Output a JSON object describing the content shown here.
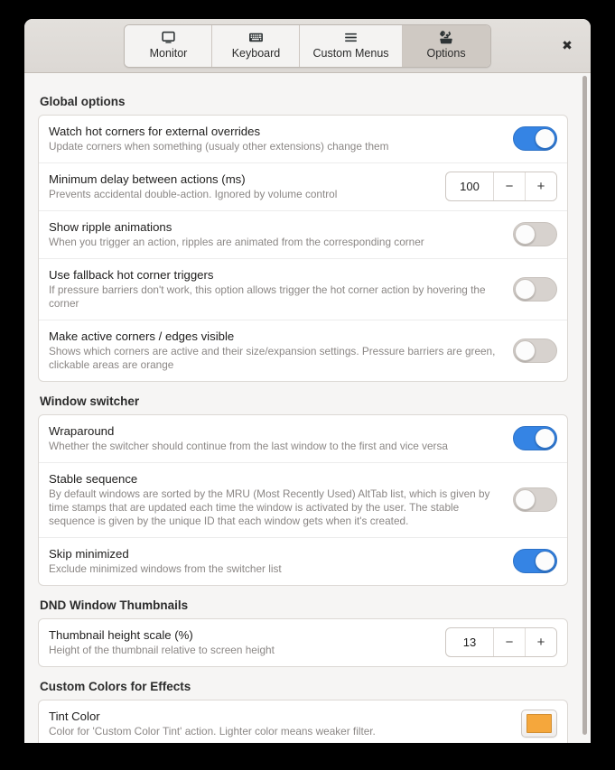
{
  "window": {
    "close_label": "✖"
  },
  "tabs": [
    {
      "label": "Monitor",
      "icon": "monitor-icon",
      "selected": false
    },
    {
      "label": "Keyboard",
      "icon": "keyboard-icon",
      "selected": false
    },
    {
      "label": "Custom Menus",
      "icon": "hamburger-menu-icon",
      "selected": false
    },
    {
      "label": "Options",
      "icon": "preferences-icon",
      "selected": true
    }
  ],
  "sections": [
    {
      "title": "Global options",
      "rows": [
        {
          "name": "watch-hot-corners",
          "title": "Watch hot corners for external overrides",
          "subtitle": "Update corners when something (usualy other extensions) change them",
          "control": "switch",
          "value": "on"
        },
        {
          "name": "minimum-delay",
          "title": "Minimum delay between actions (ms)",
          "subtitle": "Prevents accidental double-action. Ignored by volume control",
          "control": "spin",
          "value": "100",
          "minus_label": "−",
          "plus_label": "+"
        },
        {
          "name": "show-ripple-animations",
          "title": "Show ripple animations",
          "subtitle": "When you trigger an action, ripples are animated from the corresponding corner",
          "control": "switch",
          "value": "off"
        },
        {
          "name": "use-fallback-triggers",
          "title": "Use fallback hot corner triggers",
          "subtitle": "If pressure barriers don't work, this option allows trigger the hot corner action by hovering the corner",
          "control": "switch",
          "value": "off"
        },
        {
          "name": "make-corners-visible",
          "title": "Make active corners / edges visible",
          "subtitle": "Shows which corners are active and their size/expansion settings. Pressure barriers are green, clickable areas are orange",
          "control": "switch",
          "value": "off"
        }
      ]
    },
    {
      "title": "Window switcher",
      "rows": [
        {
          "name": "wraparound",
          "title": "Wraparound",
          "subtitle": "Whether the switcher should continue from the last window to the first and vice versa",
          "control": "switch",
          "value": "on"
        },
        {
          "name": "stable-sequence",
          "title": "Stable sequence",
          "subtitle": "By default windows are sorted by the MRU (Most Recently Used) AltTab list, which is given by time stamps that are updated each time the window is activated by the user. The stable sequence is given by the unique ID that each window gets when it's created.",
          "control": "switch",
          "value": "off"
        },
        {
          "name": "skip-minimized",
          "title": "Skip minimized",
          "subtitle": "Exclude minimized windows from the switcher list",
          "control": "switch",
          "value": "on"
        }
      ]
    },
    {
      "title": "DND Window Thumbnails",
      "rows": [
        {
          "name": "thumbnail-height-scale",
          "title": "Thumbnail height scale (%)",
          "subtitle": "Height of the thumbnail relative to screen height",
          "control": "spin",
          "value": "13",
          "minus_label": "−",
          "plus_label": "+"
        }
      ]
    },
    {
      "title": "Custom Colors for Effects",
      "rows": [
        {
          "name": "tint-color",
          "title": "Tint Color",
          "subtitle": "Color for 'Custom Color Tint' action. Lighter color means weaker filter.",
          "control": "color",
          "value": "#f5a73c"
        }
      ]
    }
  ],
  "colors": {
    "accent_blue": "#3584e4",
    "switch_off": "#d7d2ce",
    "tint_orange": "#f5a73c",
    "headerbar": "#dedad6",
    "content_bg": "#f6f5f4"
  }
}
